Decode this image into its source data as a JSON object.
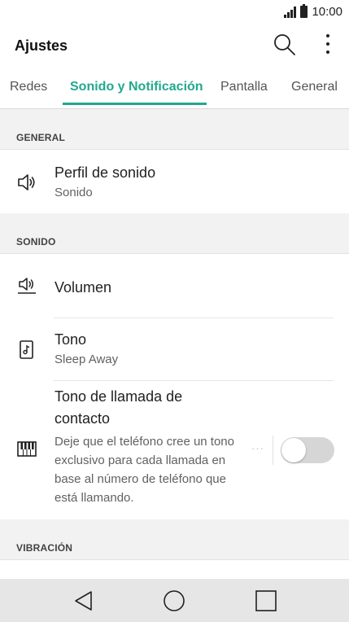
{
  "status_bar": {
    "time": "10:00",
    "icons": [
      "signal-icon",
      "battery-icon"
    ]
  },
  "app_bar": {
    "title": "Ajustes",
    "search_icon": "search-icon",
    "more_icon": "more-vert-icon"
  },
  "tabs": [
    {
      "label": "Redes",
      "active": false
    },
    {
      "label": "Sonido y Notificación",
      "active": true
    },
    {
      "label": "Pantalla",
      "active": false
    },
    {
      "label": "General",
      "active": false
    }
  ],
  "accent_color": "#21a98e",
  "sections": {
    "general": {
      "header": "GENERAL",
      "items": [
        {
          "title": "Perfil de sonido",
          "subtitle": "Sonido",
          "icon": "speaker-icon"
        }
      ]
    },
    "sonido": {
      "header": "SONIDO",
      "items": [
        {
          "title": "Volumen",
          "icon": "volume-icon"
        },
        {
          "title": "Tono",
          "subtitle": "Sleep Away",
          "icon": "ringtone-icon"
        },
        {
          "title": "Tono de llamada de contacto",
          "description": "Deje que el teléfono cree un tono exclusivo para cada llamada en base al número de teléfono que está llamando.",
          "icon": "piano-icon",
          "more_label": "···",
          "toggle_on": false
        }
      ]
    },
    "vibracion": {
      "header": "VIBRACIÓN"
    }
  },
  "nav_bar": {
    "icons": [
      "back-icon",
      "home-icon",
      "recents-icon"
    ]
  }
}
